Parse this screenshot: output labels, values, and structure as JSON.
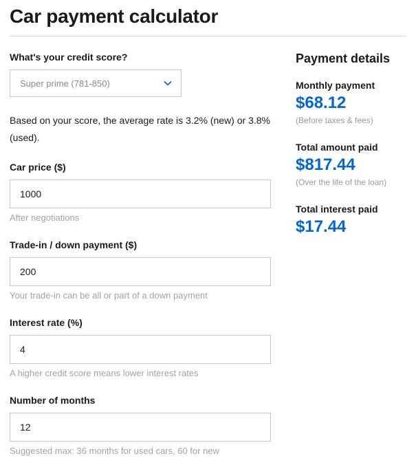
{
  "title": "Car payment calculator",
  "form": {
    "credit_score": {
      "label": "What's your credit score?",
      "selected": "Super prime (781-850)"
    },
    "rate_info": "Based on your score, the average rate is 3.2% (new) or 3.8% (used).",
    "car_price": {
      "label": "Car price ($)",
      "value": "1000",
      "helper": "After negotiations"
    },
    "trade_in": {
      "label": "Trade-in / down payment ($)",
      "value": "200",
      "helper": "Your trade-in can be all or part of a down payment"
    },
    "interest_rate": {
      "label": "Interest rate (%)",
      "value": "4",
      "helper": "A higher credit score means lower interest rates"
    },
    "months": {
      "label": "Number of months",
      "value": "12",
      "helper": "Suggested max: 36 months for used cars, 60 for new"
    }
  },
  "summary": {
    "title": "Payment details",
    "monthly": {
      "label": "Monthly payment",
      "value": "$68.12",
      "note": "(Before taxes & fees)"
    },
    "total_paid": {
      "label": "Total amount paid",
      "value": "$817.44",
      "note": "(Over the life of the loan)"
    },
    "total_interest": {
      "label": "Total interest paid",
      "value": "$17.44"
    }
  }
}
